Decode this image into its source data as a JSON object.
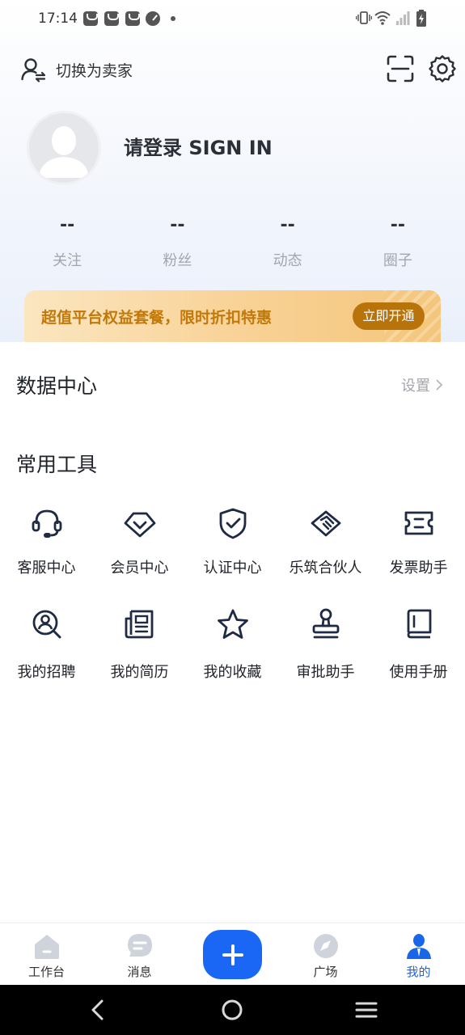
{
  "status_bar": {
    "time": "17:14"
  },
  "header": {
    "switch_label": "切换为卖家"
  },
  "profile": {
    "login_title": "请登录 SIGN IN"
  },
  "stats": [
    {
      "value": "--",
      "label": "关注"
    },
    {
      "value": "--",
      "label": "粉丝"
    },
    {
      "value": "--",
      "label": "动态"
    },
    {
      "value": "--",
      "label": "圈子"
    }
  ],
  "promo": {
    "text": "超值平台权益套餐，限时折扣特惠",
    "button": "立即开通"
  },
  "data_center": {
    "title": "数据中心",
    "settings": "设置"
  },
  "tools": {
    "title": "常用工具",
    "items": [
      {
        "label": "客服中心",
        "icon": "headset-icon"
      },
      {
        "label": "会员中心",
        "icon": "diamond-icon"
      },
      {
        "label": "认证中心",
        "icon": "shield-check-icon"
      },
      {
        "label": "乐筑合伙人",
        "icon": "handshake-icon"
      },
      {
        "label": "发票助手",
        "icon": "ticket-icon"
      },
      {
        "label": "我的招聘",
        "icon": "person-search-icon"
      },
      {
        "label": "我的简历",
        "icon": "newspaper-icon"
      },
      {
        "label": "我的收藏",
        "icon": "star-icon"
      },
      {
        "label": "审批助手",
        "icon": "stamp-icon"
      },
      {
        "label": "使用手册",
        "icon": "book-icon"
      }
    ]
  },
  "bottom_nav": {
    "items": [
      {
        "label": "工作台"
      },
      {
        "label": "消息"
      },
      {
        "label": "广场"
      },
      {
        "label": "我的"
      }
    ]
  },
  "colors": {
    "accent": "#1a66f5",
    "promo_text": "#c2790a",
    "promo_button": "#b8730b"
  }
}
